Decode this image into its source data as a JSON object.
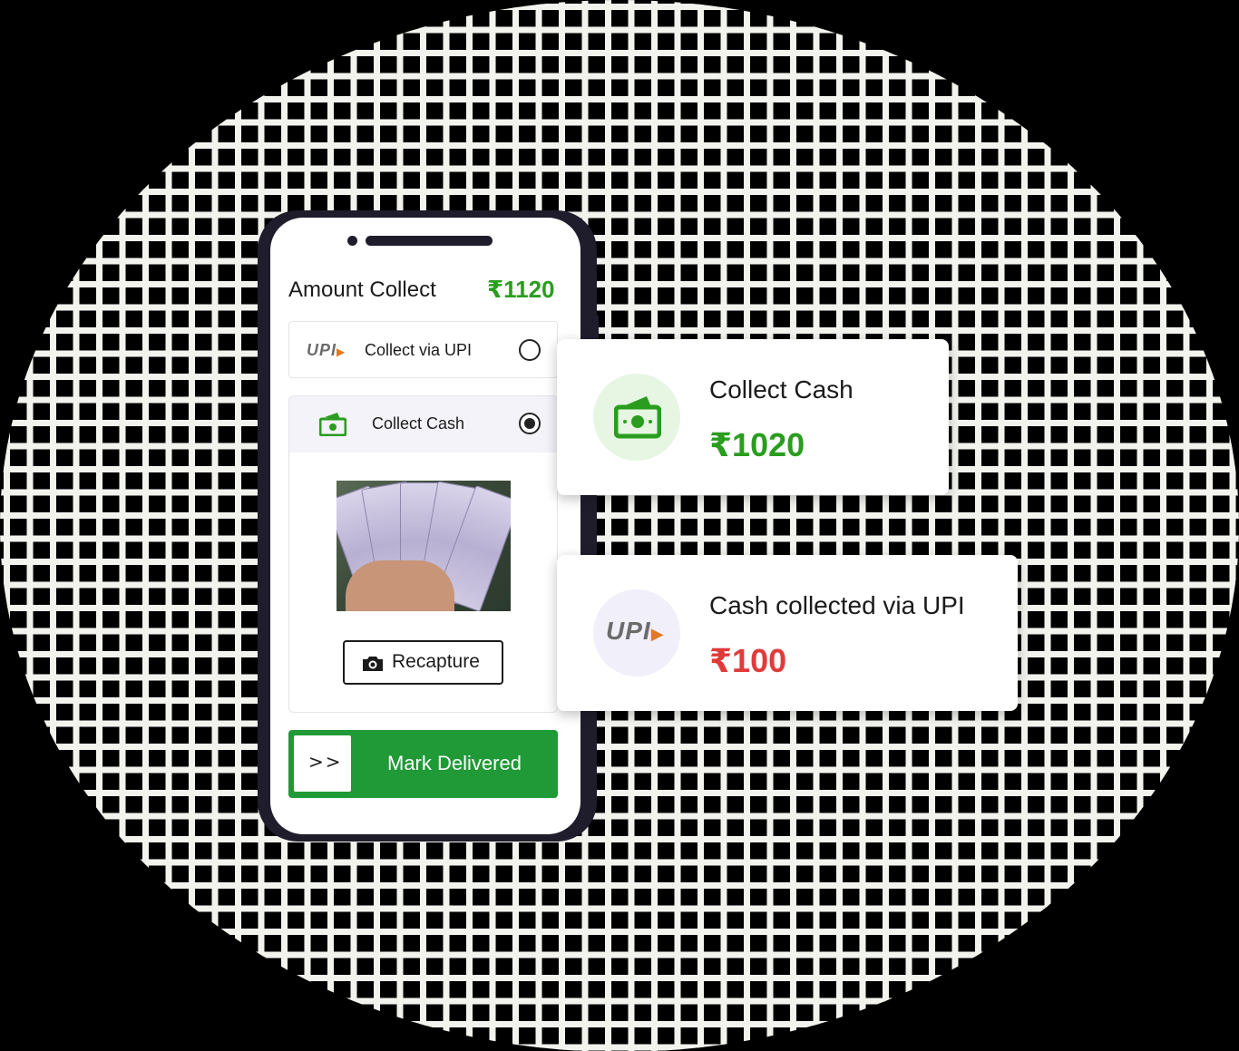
{
  "phone": {
    "title": "Amount Collect",
    "total_amount": "₹1120",
    "options": [
      {
        "label": "Collect via UPI",
        "logo": "UPI",
        "selected": false
      },
      {
        "label": "Collect Cash",
        "icon": "cash-icon",
        "selected": true
      }
    ],
    "recapture_label": "Recapture",
    "mark_delivered_label": "Mark Delivered",
    "slider_arrows": ">>"
  },
  "cards": [
    {
      "title": "Collect Cash",
      "amount": "₹1020",
      "icon": "cash-icon",
      "amount_color": "#2a9d1f"
    },
    {
      "title": "Cash collected via UPI",
      "amount": "₹100",
      "logo": "UPI",
      "amount_color": "#e03b3b"
    }
  ],
  "colors": {
    "brand_green": "#1f9a36",
    "amount_green": "#2a9d1f",
    "amount_red": "#e03b3b",
    "phone_frame": "#1f1d2b"
  }
}
